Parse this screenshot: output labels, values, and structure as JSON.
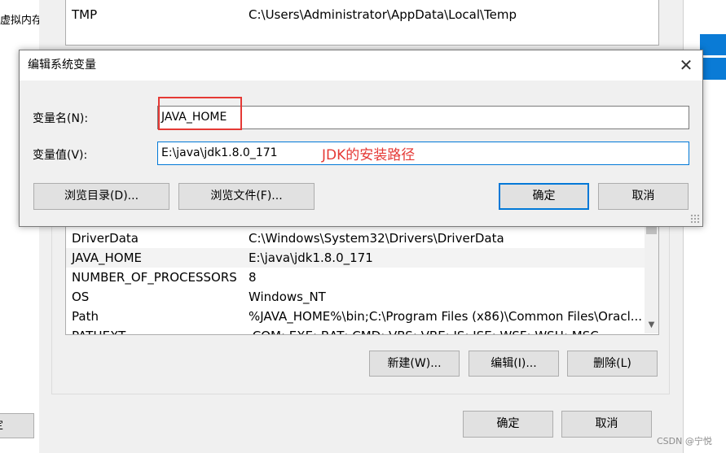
{
  "left_window": {
    "text": "虚拟内存",
    "button_label": "定"
  },
  "env_top_list": [
    {
      "name": "TMP",
      "value": "C:\\Users\\Administrator\\AppData\\Local\\Temp"
    }
  ],
  "env_list": [
    {
      "name": "DriverData",
      "value": "C:\\Windows\\System32\\Drivers\\DriverData"
    },
    {
      "name": "JAVA_HOME",
      "value": "E:\\java\\jdk1.8.0_171",
      "selected": true
    },
    {
      "name": "NUMBER_OF_PROCESSORS",
      "value": "8"
    },
    {
      "name": "OS",
      "value": "Windows_NT"
    },
    {
      "name": "Path",
      "value": "%JAVA_HOME%\\bin;C:\\Program Files (x86)\\Common Files\\Oracl..."
    },
    {
      "name": "PATHEXT",
      "value": ".COM;.EXE;.BAT;.CMD;.VBS;.VBE;.JS;.JSE;.WSF;.WSH;.MSC"
    }
  ],
  "env_buttons": {
    "new": "新建(W)...",
    "edit": "编辑(I)...",
    "delete": "删除(L)"
  },
  "env_footer": {
    "ok": "确定",
    "cancel": "取消"
  },
  "dialog": {
    "title": "编辑系统变量",
    "close_glyph": "✕",
    "name_label": "变量名(N):",
    "name_value": "JAVA_HOME",
    "value_label": "变量值(V):",
    "value_value": "E:\\java\\jdk1.8.0_171",
    "annotation": "JDK的安装路径",
    "browse_dir": "浏览目录(D)...",
    "browse_file": "浏览文件(F)...",
    "ok": "确定",
    "cancel": "取消"
  },
  "watermark": "CSDN @宁悦",
  "colors": {
    "annotation": "#e53935",
    "accent": "#0078d7",
    "windows_logo": "#0a7bd6"
  },
  "icons": {
    "close": "close-icon",
    "logo": "windows-logo-icon",
    "scroll_down": "chevron-down-icon"
  }
}
